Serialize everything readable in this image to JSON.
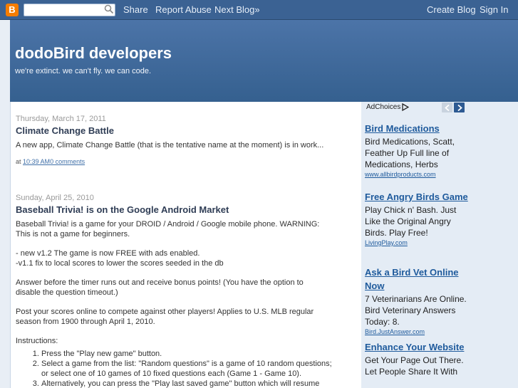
{
  "navbar": {
    "logo_letter": "B",
    "search_placeholder": "",
    "share": "Share",
    "report_abuse": "Report Abuse",
    "next_blog": "Next Blog»",
    "create_blog": "Create Blog",
    "sign_in": "Sign In"
  },
  "header": {
    "title": "dodoBird developers",
    "description": "we're extinct. we can't fly. we can code."
  },
  "posts": [
    {
      "date": "Thursday, March 17, 2011",
      "title": "Climate Change Battle",
      "body": "A new app, Climate Change Battle (that is the tentative name at the moment) is in work...",
      "footer_prefix": "at",
      "time": "10:39 AM",
      "comments": "0 comments"
    },
    {
      "date": "Sunday, April 25, 2010",
      "title": "Baseball Trivia! is on the Google Android Market",
      "lines": [
        "Baseball Trivia! is a game for your DROID / Android / Google mobile phone. WARNING:",
        "This is not a game for beginners.",
        "- new v1.2 The game is now FREE with ads enabled.",
        "-v1.1 fix to local scores to lower the scores seeded in the db",
        "Answer before the timer runs out and receive bonus points! (You have the option to",
        "disable the question timeout.)",
        "Post your scores online to compete against other players! Applies to U.S. MLB regular",
        "season from 1900 through April 1, 2010.",
        "Instructions:"
      ],
      "steps": [
        "Press the \"Play new game\" button.",
        "Select a game from the list: \"Random questions\" is a game of 10 random questions;",
        "or select one of 10 games of 10 fixed questions each (Game 1 - Game 10).",
        "Alternatively, you can press the \"Play last saved game\" button which will resume"
      ]
    }
  ],
  "ads": {
    "adchoices_label": "AdChoices",
    "items": [
      {
        "title": "Bird Medications",
        "text": "Bird Medications, Scatt, Feather Up Full line of Medications, Herbs",
        "url": "www.allbirdproducts.com"
      },
      {
        "title": "Free Angry Birds Game",
        "text": "Play Chick n' Bash. Just Like the Original Angry Birds. Play Free!",
        "url": "LivingPlay.com"
      },
      {
        "title": "Ask a Bird Vet Online Now",
        "text": "7 Veterinarians Are Online. Bird Veterinary Answers Today: 8.",
        "url": "Bird.JustAnswer.com"
      },
      {
        "title": "Enhance Your Website",
        "text": "Get Your Page Out There. Let People Share It With",
        "url": ""
      }
    ]
  },
  "colors": {
    "navbar": "#3b6293",
    "header": "#4c74a8",
    "ad_link": "#1e5a9c",
    "post_title": "#2f3d55"
  }
}
